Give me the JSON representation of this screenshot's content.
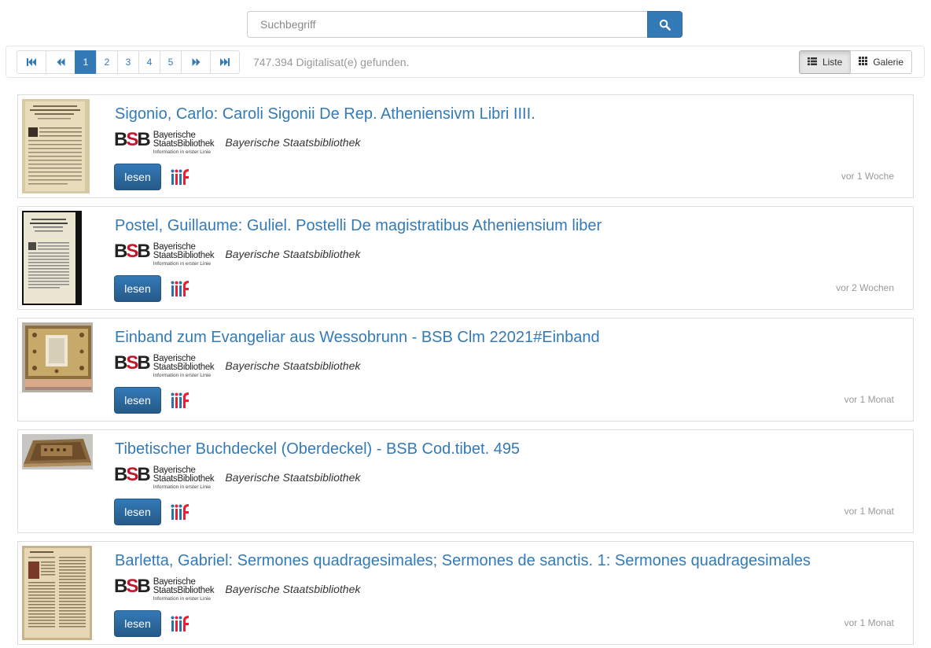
{
  "search": {
    "placeholder": "Suchbegriff",
    "button_icon": "search-icon"
  },
  "pager": {
    "first_icon": "first-page-icon",
    "prev_icon": "prev-page-icon",
    "pages": [
      "1",
      "2",
      "3",
      "4",
      "5"
    ],
    "active_page": "1",
    "next_icon": "next-page-icon",
    "last_icon": "last-page-icon"
  },
  "result_count": "747.394 Digitalisat(e) gefunden.",
  "view": {
    "list_label": "Liste",
    "gallery_label": "Galerie",
    "active": "Liste"
  },
  "library_logo": {
    "letters": "BSB",
    "line1": "Bayerische",
    "line2": "StaatsBibliothek",
    "tagline": "Information in erster Linie"
  },
  "results": [
    {
      "title": "Sigonio, Carlo: Caroli Sigonii De Rep. Atheniensivm Libri IIII.",
      "library": "Bayerische Staatsbibliothek",
      "read_label": "lesen",
      "iiif_icon": "iiif-icon",
      "age": "vor 1 Woche"
    },
    {
      "title": "Postel, Guillaume: Guliel. Postelli De magistratibus Atheniensium liber",
      "library": "Bayerische Staatsbibliothek",
      "read_label": "lesen",
      "iiif_icon": "iiif-icon",
      "age": "vor 2 Wochen"
    },
    {
      "title": "Einband zum Evangeliar aus Wessobrunn - BSB Clm 22021#Einband",
      "library": "Bayerische Staatsbibliothek",
      "read_label": "lesen",
      "iiif_icon": "iiif-icon",
      "age": "vor 1 Monat"
    },
    {
      "title": "Tibetischer Buchdeckel (Oberdeckel) - BSB Cod.tibet. 495",
      "library": "Bayerische Staatsbibliothek",
      "read_label": "lesen",
      "iiif_icon": "iiif-icon",
      "age": "vor 1 Monat"
    },
    {
      "title": "Barletta, Gabriel: Sermones quadragesimales; Sermones de sanctis. 1: Sermones quadragesimales",
      "library": "Bayerische Staatsbibliothek",
      "read_label": "lesen",
      "iiif_icon": "iiif-icon",
      "age": "vor 1 Monat"
    }
  ],
  "colors": {
    "link": "#337ab7",
    "primary": "#265a88",
    "logo_red": "#c0182a",
    "muted": "#999999"
  }
}
